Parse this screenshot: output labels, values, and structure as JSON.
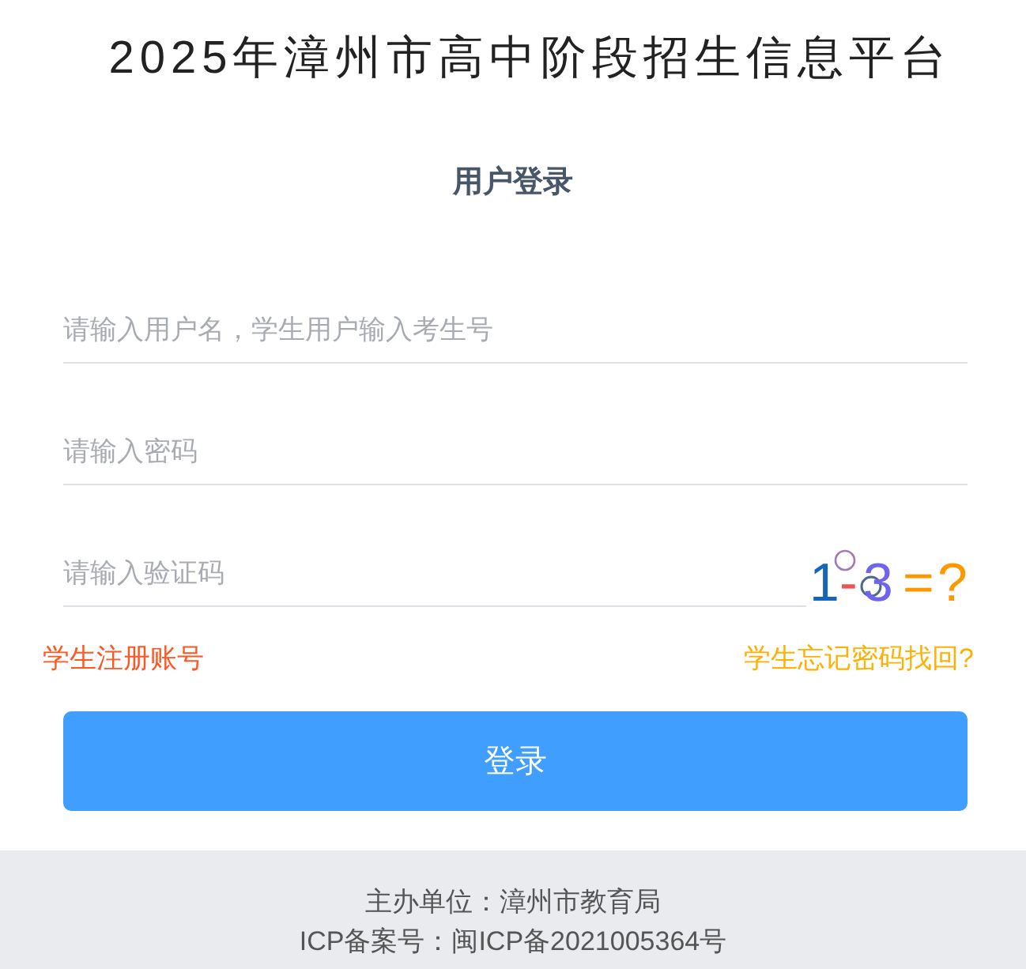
{
  "page": {
    "title": "2025年漳州市高中阶段招生信息平台"
  },
  "login": {
    "heading": "用户登录",
    "fields": [
      {
        "kind": "text",
        "placeholder": "请输入用户名，学生用户输入考生号"
      },
      {
        "kind": "password",
        "placeholder": "请输入密码"
      },
      {
        "kind": "captcha",
        "placeholder": "请输入验证码"
      }
    ],
    "captcha": {
      "text": "1-3=?"
    },
    "links": [
      {
        "label": "学生注册账号",
        "color": "#ff5722"
      },
      {
        "label": "学生忘记密码找回?",
        "color": "#ffb000"
      }
    ],
    "submit": {
      "label": "登录"
    }
  },
  "footer": {
    "lines": [
      "主办单位：漳州市教育局",
      "ICP备案号：闽ICP备2021005364号"
    ]
  }
}
